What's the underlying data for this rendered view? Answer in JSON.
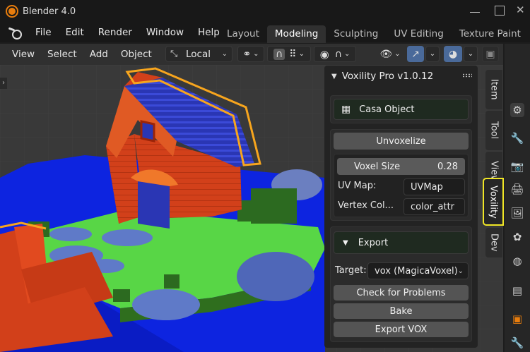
{
  "window": {
    "title": "Blender 4.0"
  },
  "menu": {
    "items": [
      "File",
      "Edit",
      "Render",
      "Window",
      "Help"
    ]
  },
  "workspaces": {
    "tabs": [
      "Layout",
      "Modeling",
      "Sculpting",
      "UV Editing",
      "Texture Paint"
    ],
    "active": "Modeling"
  },
  "viewport_header": {
    "menus": [
      "View",
      "Select",
      "Add",
      "Object"
    ],
    "pivot": "Local"
  },
  "panel": {
    "title": "Voxility Pro v1.0.12",
    "object_button": "Casa Object",
    "unvoxelize_button": "Unvoxelize",
    "voxel_size_label": "Voxel Size",
    "voxel_size_value": "0.28",
    "uv_map_label": "UV Map:",
    "uv_map_value": "UVMap",
    "vertex_color_label": "Vertex Col...",
    "vertex_color_value": "color_attr",
    "export_label": "Export",
    "target_label": "Target:",
    "target_value": "vox (MagicaVoxel)",
    "check_button": "Check for Problems",
    "bake_button": "Bake",
    "export_button": "Export VOX"
  },
  "side_tabs": [
    "Item",
    "Tool",
    "View",
    "Voxility",
    "Dev"
  ],
  "active_side_tab": "Voxility",
  "colors": {
    "accent": "#4a6a9a",
    "highlight": "#f0e626",
    "selection_outline": "#f7a51d"
  }
}
